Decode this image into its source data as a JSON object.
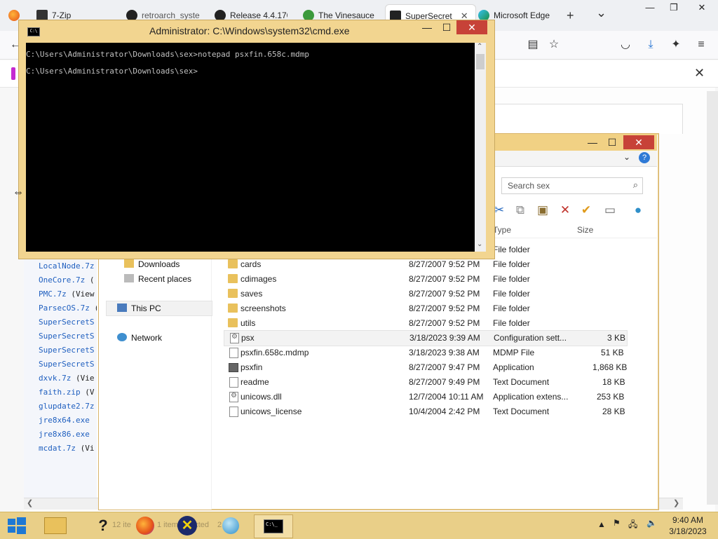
{
  "browser": {
    "tabs": [
      {
        "label": "7-Zip",
        "active": false
      },
      {
        "label": "retroarch_syste",
        "active": false
      },
      {
        "label": "Release 4.4.170",
        "active": false
      },
      {
        "label": "The Vinesauce",
        "active": false
      },
      {
        "label": "SuperSecret",
        "active": true
      },
      {
        "label": "Microsoft Edge",
        "active": false
      }
    ],
    "new_tab": "+",
    "tab_list": "⌄",
    "close_tab": "✕"
  },
  "left_list": {
    "items": [
      {
        "name": "LocalNode.7z",
        "paren": "("
      },
      {
        "name": "OneCore.7z",
        "paren": "("
      },
      {
        "name": "PMC.7z",
        "paren": "(View"
      },
      {
        "name": "ParsecOS.7z",
        "paren": "("
      },
      {
        "name": "SuperSecretS",
        "paren": ""
      },
      {
        "name": "SuperSecretS",
        "paren": ""
      },
      {
        "name": "SuperSecretS",
        "paren": ""
      },
      {
        "name": "SuperSecretS",
        "paren": ""
      },
      {
        "name": "dxvk.7z",
        "paren": "(Vie"
      },
      {
        "name": "faith.zip",
        "paren": "(V"
      },
      {
        "name": "glupdate2.7z",
        "paren": ""
      },
      {
        "name": "jre8x64.exe",
        "paren": ""
      },
      {
        "name": "jre8x86.exe",
        "paren": ""
      },
      {
        "name": "mcdat.7z",
        "paren": "(Vi"
      }
    ]
  },
  "explorer": {
    "search_placeholder": "Search sex",
    "columns": {
      "type": "Type",
      "size": "Size"
    },
    "nav": {
      "downloads": "Downloads",
      "recent": "Recent places",
      "this_pc": "This PC",
      "network": "Network"
    },
    "rows": [
      {
        "name": "",
        "date": "",
        "type": "File folder",
        "size": "",
        "icon": "none"
      },
      {
        "name": "cards",
        "date": "8/27/2007 9:52 PM",
        "type": "File folder",
        "size": "",
        "icon": "folder"
      },
      {
        "name": "cdimages",
        "date": "8/27/2007 9:52 PM",
        "type": "File folder",
        "size": "",
        "icon": "folder"
      },
      {
        "name": "saves",
        "date": "8/27/2007 9:52 PM",
        "type": "File folder",
        "size": "",
        "icon": "folder"
      },
      {
        "name": "screenshots",
        "date": "8/27/2007 9:52 PM",
        "type": "File folder",
        "size": "",
        "icon": "folder"
      },
      {
        "name": "utils",
        "date": "8/27/2007 9:52 PM",
        "type": "File folder",
        "size": "",
        "icon": "folder"
      },
      {
        "name": "psx",
        "date": "3/18/2023 9:39 AM",
        "type": "Configuration sett...",
        "size": "3 KB",
        "icon": "cfg"
      },
      {
        "name": "psxfin.658c.mdmp",
        "date": "3/18/2023 9:38 AM",
        "type": "MDMP File",
        "size": "51 KB",
        "icon": "file"
      },
      {
        "name": "psxfin",
        "date": "8/27/2007 9:47 PM",
        "type": "Application",
        "size": "1,868 KB",
        "icon": "app"
      },
      {
        "name": "readme",
        "date": "8/27/2007 9:49 PM",
        "type": "Text Document",
        "size": "18 KB",
        "icon": "file"
      },
      {
        "name": "unicows.dll",
        "date": "12/7/2004 10:11 AM",
        "type": "Application extens...",
        "size": "253 KB",
        "icon": "cfg"
      },
      {
        "name": "unicows_license",
        "date": "10/4/2004 2:42 PM",
        "type": "Text Document",
        "size": "28 KB",
        "icon": "file"
      }
    ]
  },
  "cmd": {
    "title": "Administrator: C:\\Windows\\system32\\cmd.exe",
    "icon_text": "C:\\",
    "lines": [
      "C:\\Users\\Administrator\\Downloads\\sex>notepad psxfin.658c.mdmp",
      "C:\\Users\\Administrator\\Downloads\\sex>"
    ]
  },
  "taskbar": {
    "status_items": "12 ite",
    "status_selected": "1 item selected",
    "status_size": "2",
    "time": "9:40 AM",
    "date": "3/18/2023"
  }
}
